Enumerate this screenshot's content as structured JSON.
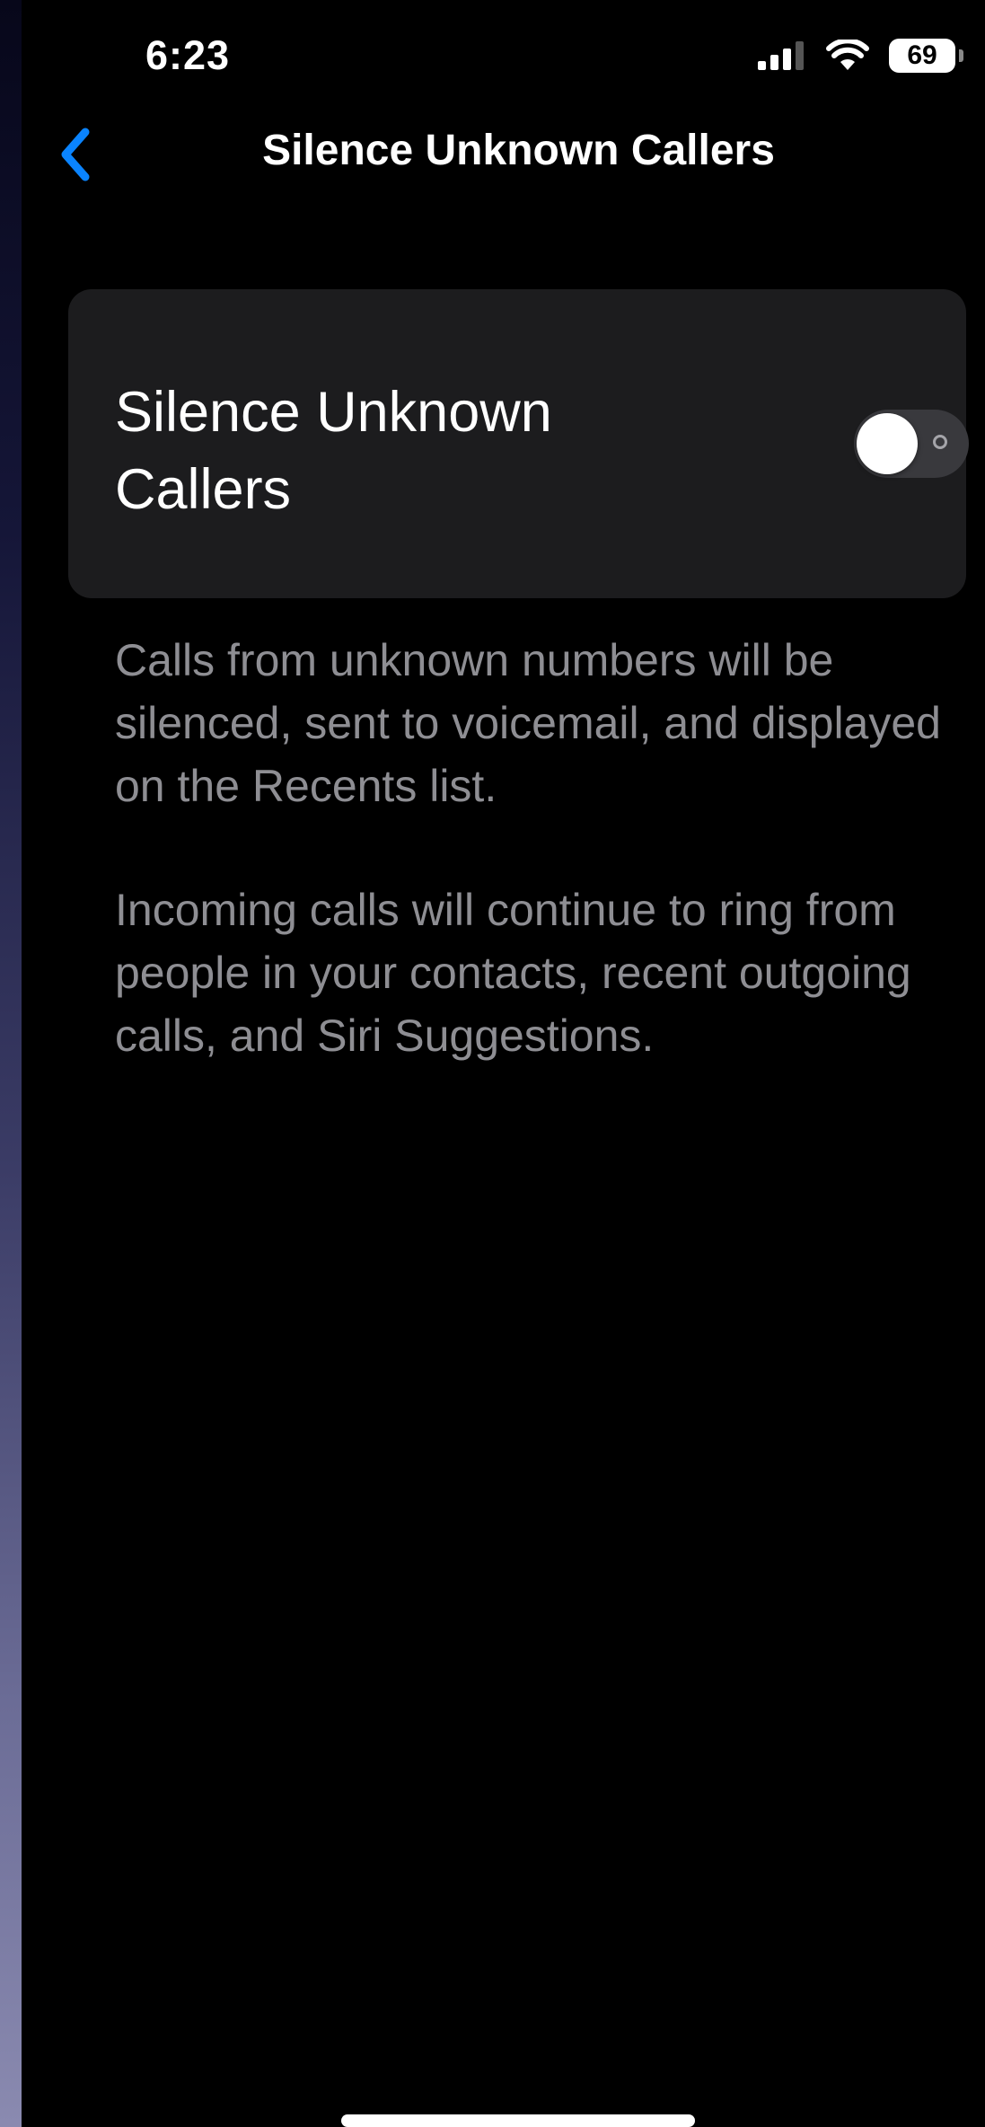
{
  "status_bar": {
    "time": "6:23",
    "battery": "69",
    "icons": [
      "cellular-signal-icon",
      "wifi-icon",
      "battery-icon"
    ]
  },
  "nav": {
    "back_icon": "chevron-left-icon",
    "title": "Silence Unknown Callers"
  },
  "setting": {
    "label": "Silence Unknown Callers",
    "toggle_on": false
  },
  "footer": {
    "paragraph_1": "Calls from unknown numbers will be silenced, sent to voicemail, and displayed on the Recents list.",
    "paragraph_2": "Incoming calls will continue to ring from people in your contacts, recent outgoing calls, and Siri Suggestions."
  },
  "colors": {
    "background": "#000000",
    "card": "#1c1c1e",
    "accent": "#0a84ff",
    "secondary_text": "#8e8e93",
    "toggle_track_off": "#39393d"
  }
}
